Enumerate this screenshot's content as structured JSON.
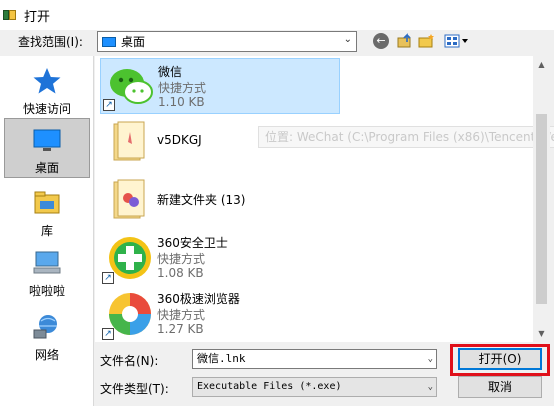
{
  "window": {
    "title": "打开"
  },
  "lookin": {
    "label": "查找范围(I):",
    "value": "桌面"
  },
  "toolbar": {
    "back_icon": "back-arrow-icon",
    "up_icon": "up-folder-icon",
    "newfolder_icon": "new-folder-icon",
    "views_icon": "view-menu-icon"
  },
  "places": [
    {
      "label": "快速访问",
      "icon": "star-icon"
    },
    {
      "label": "桌面",
      "icon": "desktop-icon",
      "selected": true
    },
    {
      "label": "库",
      "icon": "library-icon"
    },
    {
      "label": "啦啦啦",
      "icon": "computer-icon"
    },
    {
      "label": "网络",
      "icon": "network-icon"
    }
  ],
  "files": [
    {
      "name": "微信",
      "type": "快捷方式",
      "size": "1.10 KB",
      "icon": "wechat-icon",
      "selected": true
    },
    {
      "name": "v5DKGJ",
      "icon": "folder-icon"
    },
    {
      "name": "新建文件夹 (13)",
      "icon": "folder-icon"
    },
    {
      "name": "360安全卫士",
      "type": "快捷方式",
      "size": "1.08 KB",
      "icon": "360-safe-icon"
    },
    {
      "name": "360极速浏览器",
      "type": "快捷方式",
      "size": "1.27 KB",
      "icon": "360-browser-icon"
    }
  ],
  "tooltip": "位置: WeChat (C:\\Program Files (x86)\\Tencent\\WeC",
  "filename": {
    "label": "文件名(N):",
    "value": "微信.lnk"
  },
  "filetype": {
    "label": "文件类型(T):",
    "value": "Executable Files (*.exe)"
  },
  "buttons": {
    "open": "打开(O)",
    "cancel": "取消"
  },
  "colors": {
    "selection": "#cce8ff",
    "highlight": "#e0101a",
    "accent": "#0078d7"
  }
}
